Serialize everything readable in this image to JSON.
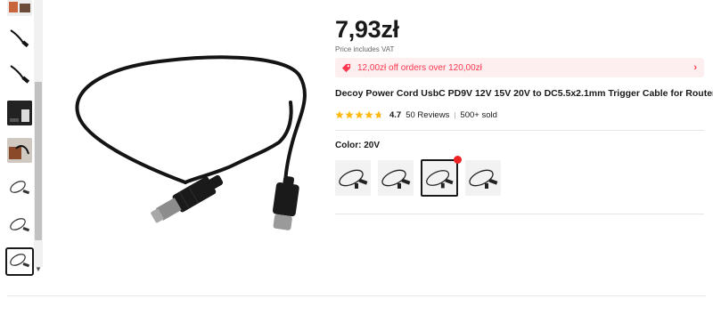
{
  "product": {
    "price": "7,93zł",
    "vat_note": "Price includes VAT",
    "promo": "12,00zł off orders over 120,00zł",
    "title": "Decoy Power Cord UsbC PD9V 12V 15V 20V to DC5.5x2.1mm Trigger Cable for Router",
    "rating": "4.7",
    "stars_value": 4.7,
    "stars_max": 5,
    "reviews": "50 Reviews",
    "sold": "500+ sold",
    "color_label": "Color: 20V"
  },
  "colors": {
    "accent": "#fd384f",
    "promo_bg": "#fdeef0",
    "star": "#fdb913",
    "hot_dot": "#e22222"
  },
  "thumbnails": [
    {
      "icon": "orange-packaging-icon"
    },
    {
      "icon": "cable-photo-icon"
    },
    {
      "icon": "cable-photo-icon"
    },
    {
      "icon": "device-photo-icon"
    },
    {
      "icon": "product-in-hand-icon"
    },
    {
      "icon": "cable-outline-icon"
    },
    {
      "icon": "cable-outline-icon"
    },
    {
      "icon": "cable-outline-icon",
      "selected": true
    }
  ],
  "swatches": [
    {
      "icon": "cable-outline-icon"
    },
    {
      "icon": "cable-outline-icon"
    },
    {
      "icon": "cable-outline-icon",
      "selected": true,
      "hot": true
    },
    {
      "icon": "cable-outline-icon"
    }
  ]
}
